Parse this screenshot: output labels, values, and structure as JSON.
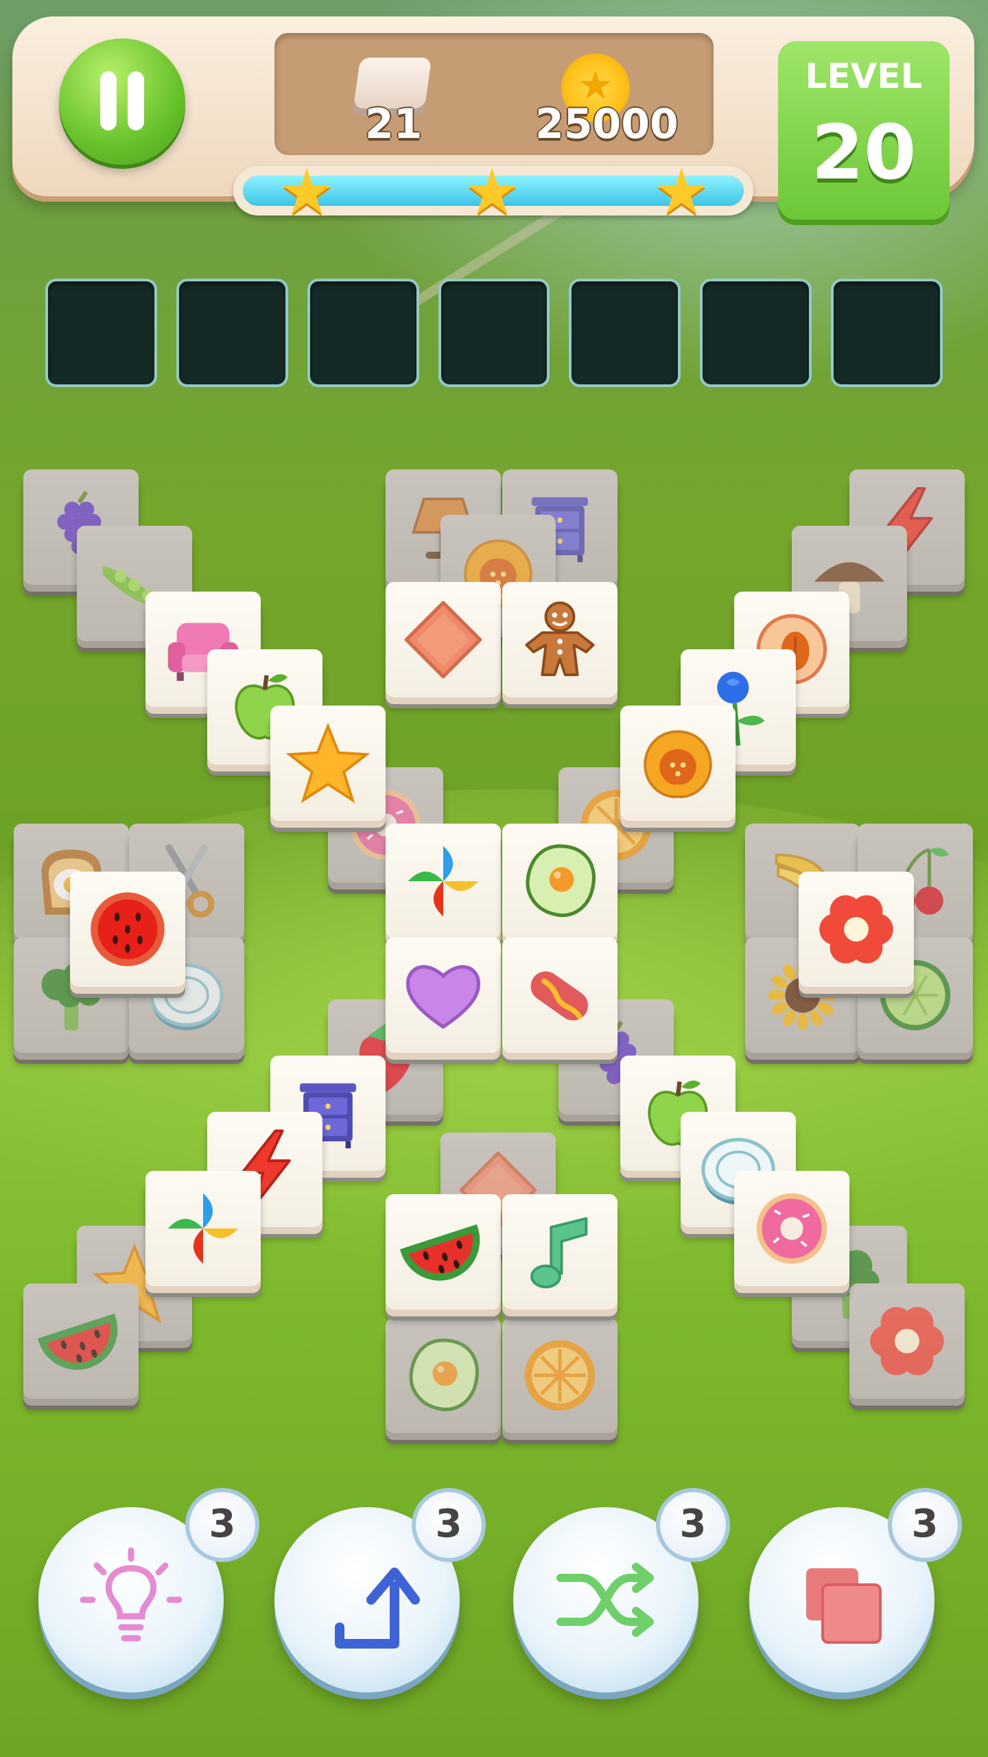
{
  "hud": {
    "tiles_left": "21",
    "coins": "25000",
    "level_label": "LEVEL",
    "level_number": "20",
    "progress_fraction": 1.0,
    "stars": 3
  },
  "slots": {
    "count": 7,
    "filled": 0
  },
  "tiles": [
    {
      "icon": "grapes",
      "state": "blocked"
    },
    {
      "icon": "pea-pod",
      "state": "blocked"
    },
    {
      "icon": "armchair",
      "state": "free"
    },
    {
      "icon": "green-apple",
      "state": "free"
    },
    {
      "icon": "star",
      "state": "free"
    },
    {
      "icon": "table-lamp",
      "state": "blocked"
    },
    {
      "icon": "nightstand",
      "state": "blocked"
    },
    {
      "icon": "pumpkin",
      "state": "blocked"
    },
    {
      "icon": "orange-diamond",
      "state": "free"
    },
    {
      "icon": "gingerbread-man",
      "state": "free"
    },
    {
      "icon": "lightning",
      "state": "blocked"
    },
    {
      "icon": "mushroom",
      "state": "blocked"
    },
    {
      "icon": "peach",
      "state": "free"
    },
    {
      "icon": "blue-rose",
      "state": "free"
    },
    {
      "icon": "pumpkin",
      "state": "free"
    },
    {
      "icon": "orange-slice",
      "state": "blocked"
    },
    {
      "icon": "donut",
      "state": "blocked"
    },
    {
      "icon": "toast-egg",
      "state": "blocked"
    },
    {
      "icon": "scissors",
      "state": "blocked"
    },
    {
      "icon": "watermelon-round",
      "state": "free"
    },
    {
      "icon": "broccoli",
      "state": "blocked"
    },
    {
      "icon": "plate",
      "state": "blocked"
    },
    {
      "icon": "pinwheel",
      "state": "free"
    },
    {
      "icon": "fried-egg",
      "state": "free"
    },
    {
      "icon": "purple-heart",
      "state": "free"
    },
    {
      "icon": "hot-dog",
      "state": "free"
    },
    {
      "icon": "banana",
      "state": "blocked"
    },
    {
      "icon": "cherries",
      "state": "blocked"
    },
    {
      "icon": "red-flower",
      "state": "free"
    },
    {
      "icon": "sunflower",
      "state": "blocked"
    },
    {
      "icon": "cucumber-slice",
      "state": "blocked"
    },
    {
      "icon": "strawberry",
      "state": "blocked"
    },
    {
      "icon": "grapes",
      "state": "blocked"
    },
    {
      "icon": "nightstand",
      "state": "free"
    },
    {
      "icon": "lightning",
      "state": "free"
    },
    {
      "icon": "pinwheel",
      "state": "free"
    },
    {
      "icon": "star",
      "state": "blocked"
    },
    {
      "icon": "watermelon",
      "state": "blocked"
    },
    {
      "icon": "green-apple",
      "state": "free"
    },
    {
      "icon": "plate",
      "state": "free"
    },
    {
      "icon": "donut",
      "state": "free"
    },
    {
      "icon": "broccoli",
      "state": "blocked"
    },
    {
      "icon": "red-flower",
      "state": "blocked"
    },
    {
      "icon": "orange-diamond",
      "state": "blocked"
    },
    {
      "icon": "watermelon",
      "state": "free"
    },
    {
      "icon": "music-note",
      "state": "free"
    },
    {
      "icon": "fried-egg",
      "state": "blocked"
    },
    {
      "icon": "orange-slice",
      "state": "blocked"
    }
  ],
  "boosters": [
    {
      "name": "hint",
      "icon": "lightbulb-icon",
      "count": "3",
      "color": "#e48bd4"
    },
    {
      "name": "undo",
      "icon": "undo-arrow-icon",
      "count": "3",
      "color": "#3d63d6"
    },
    {
      "name": "shuffle",
      "icon": "shuffle-icon",
      "count": "3",
      "color": "#6fd06a"
    },
    {
      "name": "layers",
      "icon": "tiles-icon",
      "count": "3",
      "color": "#f08a8a"
    }
  ]
}
